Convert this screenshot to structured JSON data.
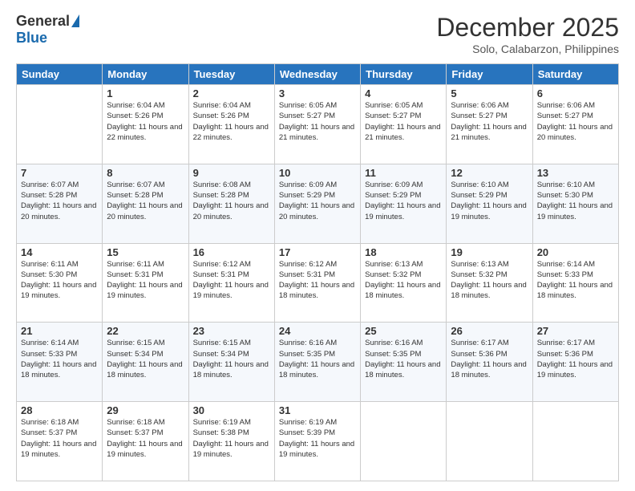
{
  "header": {
    "logo_general": "General",
    "logo_blue": "Blue",
    "month_title": "December 2025",
    "location": "Solo, Calabarzon, Philippines"
  },
  "days_of_week": [
    "Sunday",
    "Monday",
    "Tuesday",
    "Wednesday",
    "Thursday",
    "Friday",
    "Saturday"
  ],
  "weeks": [
    [
      {
        "day": "",
        "sunrise": "",
        "sunset": "",
        "daylight": ""
      },
      {
        "day": "1",
        "sunrise": "Sunrise: 6:04 AM",
        "sunset": "Sunset: 5:26 PM",
        "daylight": "Daylight: 11 hours and 22 minutes."
      },
      {
        "day": "2",
        "sunrise": "Sunrise: 6:04 AM",
        "sunset": "Sunset: 5:26 PM",
        "daylight": "Daylight: 11 hours and 22 minutes."
      },
      {
        "day": "3",
        "sunrise": "Sunrise: 6:05 AM",
        "sunset": "Sunset: 5:27 PM",
        "daylight": "Daylight: 11 hours and 21 minutes."
      },
      {
        "day": "4",
        "sunrise": "Sunrise: 6:05 AM",
        "sunset": "Sunset: 5:27 PM",
        "daylight": "Daylight: 11 hours and 21 minutes."
      },
      {
        "day": "5",
        "sunrise": "Sunrise: 6:06 AM",
        "sunset": "Sunset: 5:27 PM",
        "daylight": "Daylight: 11 hours and 21 minutes."
      },
      {
        "day": "6",
        "sunrise": "Sunrise: 6:06 AM",
        "sunset": "Sunset: 5:27 PM",
        "daylight": "Daylight: 11 hours and 20 minutes."
      }
    ],
    [
      {
        "day": "7",
        "sunrise": "Sunrise: 6:07 AM",
        "sunset": "Sunset: 5:28 PM",
        "daylight": "Daylight: 11 hours and 20 minutes."
      },
      {
        "day": "8",
        "sunrise": "Sunrise: 6:07 AM",
        "sunset": "Sunset: 5:28 PM",
        "daylight": "Daylight: 11 hours and 20 minutes."
      },
      {
        "day": "9",
        "sunrise": "Sunrise: 6:08 AM",
        "sunset": "Sunset: 5:28 PM",
        "daylight": "Daylight: 11 hours and 20 minutes."
      },
      {
        "day": "10",
        "sunrise": "Sunrise: 6:09 AM",
        "sunset": "Sunset: 5:29 PM",
        "daylight": "Daylight: 11 hours and 20 minutes."
      },
      {
        "day": "11",
        "sunrise": "Sunrise: 6:09 AM",
        "sunset": "Sunset: 5:29 PM",
        "daylight": "Daylight: 11 hours and 19 minutes."
      },
      {
        "day": "12",
        "sunrise": "Sunrise: 6:10 AM",
        "sunset": "Sunset: 5:29 PM",
        "daylight": "Daylight: 11 hours and 19 minutes."
      },
      {
        "day": "13",
        "sunrise": "Sunrise: 6:10 AM",
        "sunset": "Sunset: 5:30 PM",
        "daylight": "Daylight: 11 hours and 19 minutes."
      }
    ],
    [
      {
        "day": "14",
        "sunrise": "Sunrise: 6:11 AM",
        "sunset": "Sunset: 5:30 PM",
        "daylight": "Daylight: 11 hours and 19 minutes."
      },
      {
        "day": "15",
        "sunrise": "Sunrise: 6:11 AM",
        "sunset": "Sunset: 5:31 PM",
        "daylight": "Daylight: 11 hours and 19 minutes."
      },
      {
        "day": "16",
        "sunrise": "Sunrise: 6:12 AM",
        "sunset": "Sunset: 5:31 PM",
        "daylight": "Daylight: 11 hours and 19 minutes."
      },
      {
        "day": "17",
        "sunrise": "Sunrise: 6:12 AM",
        "sunset": "Sunset: 5:31 PM",
        "daylight": "Daylight: 11 hours and 18 minutes."
      },
      {
        "day": "18",
        "sunrise": "Sunrise: 6:13 AM",
        "sunset": "Sunset: 5:32 PM",
        "daylight": "Daylight: 11 hours and 18 minutes."
      },
      {
        "day": "19",
        "sunrise": "Sunrise: 6:13 AM",
        "sunset": "Sunset: 5:32 PM",
        "daylight": "Daylight: 11 hours and 18 minutes."
      },
      {
        "day": "20",
        "sunrise": "Sunrise: 6:14 AM",
        "sunset": "Sunset: 5:33 PM",
        "daylight": "Daylight: 11 hours and 18 minutes."
      }
    ],
    [
      {
        "day": "21",
        "sunrise": "Sunrise: 6:14 AM",
        "sunset": "Sunset: 5:33 PM",
        "daylight": "Daylight: 11 hours and 18 minutes."
      },
      {
        "day": "22",
        "sunrise": "Sunrise: 6:15 AM",
        "sunset": "Sunset: 5:34 PM",
        "daylight": "Daylight: 11 hours and 18 minutes."
      },
      {
        "day": "23",
        "sunrise": "Sunrise: 6:15 AM",
        "sunset": "Sunset: 5:34 PM",
        "daylight": "Daylight: 11 hours and 18 minutes."
      },
      {
        "day": "24",
        "sunrise": "Sunrise: 6:16 AM",
        "sunset": "Sunset: 5:35 PM",
        "daylight": "Daylight: 11 hours and 18 minutes."
      },
      {
        "day": "25",
        "sunrise": "Sunrise: 6:16 AM",
        "sunset": "Sunset: 5:35 PM",
        "daylight": "Daylight: 11 hours and 18 minutes."
      },
      {
        "day": "26",
        "sunrise": "Sunrise: 6:17 AM",
        "sunset": "Sunset: 5:36 PM",
        "daylight": "Daylight: 11 hours and 18 minutes."
      },
      {
        "day": "27",
        "sunrise": "Sunrise: 6:17 AM",
        "sunset": "Sunset: 5:36 PM",
        "daylight": "Daylight: 11 hours and 19 minutes."
      }
    ],
    [
      {
        "day": "28",
        "sunrise": "Sunrise: 6:18 AM",
        "sunset": "Sunset: 5:37 PM",
        "daylight": "Daylight: 11 hours and 19 minutes."
      },
      {
        "day": "29",
        "sunrise": "Sunrise: 6:18 AM",
        "sunset": "Sunset: 5:37 PM",
        "daylight": "Daylight: 11 hours and 19 minutes."
      },
      {
        "day": "30",
        "sunrise": "Sunrise: 6:19 AM",
        "sunset": "Sunset: 5:38 PM",
        "daylight": "Daylight: 11 hours and 19 minutes."
      },
      {
        "day": "31",
        "sunrise": "Sunrise: 6:19 AM",
        "sunset": "Sunset: 5:39 PM",
        "daylight": "Daylight: 11 hours and 19 minutes."
      },
      {
        "day": "",
        "sunrise": "",
        "sunset": "",
        "daylight": ""
      },
      {
        "day": "",
        "sunrise": "",
        "sunset": "",
        "daylight": ""
      },
      {
        "day": "",
        "sunrise": "",
        "sunset": "",
        "daylight": ""
      }
    ]
  ]
}
